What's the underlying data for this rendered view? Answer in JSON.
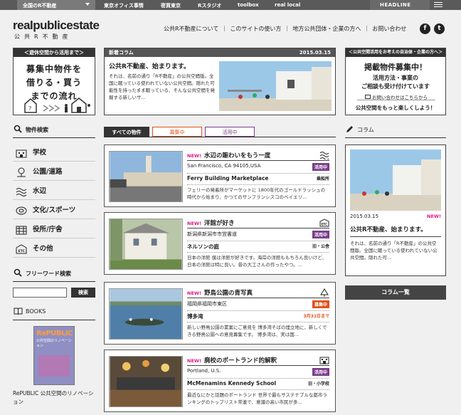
{
  "topbar": {
    "region": "全国のR不動産",
    "links": [
      "東京オフィス事情",
      "密買東京",
      "Rスタジオ",
      "toolbox",
      "real local"
    ],
    "headline": "HEADLINE"
  },
  "logo": {
    "line1": "realpublicestate",
    "line2": "公共R不動産"
  },
  "gnav": [
    "公共R不動産について",
    "｜",
    "このサイトの使い方",
    "｜",
    "地方公共団体・企業の方へ",
    "｜",
    "お問い合わせ"
  ],
  "sns": {
    "facebook": "f",
    "twitter": "t"
  },
  "promo_left": {
    "bar": "＜遊休空間から活用まで＞",
    "text_lines": [
      "募集中物件を",
      "借りる・買う",
      "までの流れ"
    ]
  },
  "news": {
    "bar_label": "新着コラム",
    "date": "2015.03.15",
    "title": "公共R不動産、始まります。",
    "body": "それは、名前の通り「R不動産」の公共空間版。全国に眠っている使われていない公共空間。隠れた可能性を持ったまま眠っている、そんな公共空間を発掘する新しいサ..."
  },
  "promo_right": {
    "bar": "＜公共空間活用をお考えの自治体・企業の方へ＞",
    "title": "掲載物件募集中！",
    "line2": "活用方法・事業の",
    "line3": "ご相談も受け付けています",
    "link": "お問い合わせはこちらから",
    "tagline": "公共空間をもっと楽しくしよう！"
  },
  "left": {
    "search_heading": "物件検索",
    "categories": [
      "学校",
      "公園/道路",
      "水辺",
      "文化/スポーツ",
      "役所/庁舎",
      "その他"
    ],
    "free_heading": "フリーワード検索",
    "search_button": "検索",
    "books_heading": "BOOKS",
    "book_title_cover": "RePUBLIC",
    "book_sub_cover": "公共空間のリノベーション",
    "book_caption": "RePUBLIC 公共空間のリノベーション"
  },
  "tabs": [
    "すべての物件",
    "募集中",
    "活用中"
  ],
  "tab_colors": {
    "all": "#333333",
    "recruiting": "#e0501a",
    "active": "#7a3d8a"
  },
  "cards": [
    {
      "new": "NEW!",
      "title": "水辺の賑わいをもう一度",
      "location": "San Francisco, CA 94105,USA",
      "badge": "活用中",
      "badge_color": "#7a3d8a",
      "name": "Ferry Building Marketplace",
      "tag": "乗船所",
      "desc": "フェリーの発着所がマーケットに 1800年代のゴールドラッシュの時代から始まり、かつてのサンフランシスコのベイエリ..."
    },
    {
      "new": "NEW!",
      "title": "洋館が好き",
      "location": "新潟県新潟市市営書道",
      "badge": "活用中",
      "badge_color": "#7a3d8a",
      "name": "ネルソンの庭",
      "tag": "旧・公舎",
      "desc": "日本の洋館 僕は洋館が好きです。海岸の洋館ももちろん良いけど、日本の洋館は特に良い。昔の大工さんの作ったやつ。..."
    },
    {
      "new": "NEW!",
      "title": "野鳥公園の青写真",
      "location": "福岡県福岡市東区",
      "badge": "募集中",
      "badge_color": "#e0501a",
      "name": "博多湾",
      "tag": "3月31日まで",
      "desc": "新しい野鳥公園の素案にご意見を 博多湾そばの埋立地に、新しくできる野鳥公園への意見募集です。 博多湾は、実は国..."
    },
    {
      "new": "NEW!",
      "title": "廃校のポートランド的解釈",
      "location": "Portland, U.S.",
      "badge": "活用中",
      "badge_color": "#7a3d8a",
      "name": "McMenamins Kennedy School",
      "tag": "旧・小学校",
      "desc": "最近なにかと話題のポートランド 世界で最もサステナブルな都市ランキングのトップリスト常連で、意識の高い市民が多..."
    }
  ],
  "column": {
    "heading": "コラム",
    "date": "2015.03.15",
    "new": "NEW!",
    "title": "公共R不動産、始まります。",
    "body": "それは、名前の通り「R不動産」の公共空間版。全国に眠っている使われていない公共空間。隠れた可...",
    "list_button": "コラム一覧"
  }
}
